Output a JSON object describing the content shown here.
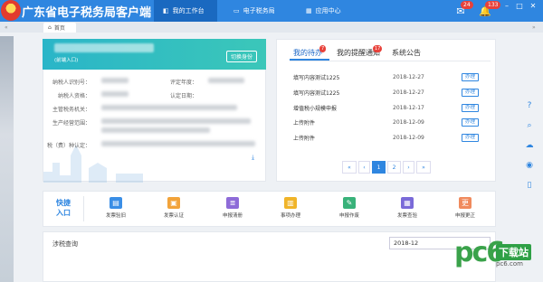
{
  "app": {
    "title": "广东省电子税务局客户端"
  },
  "nav": [
    {
      "label": "我的工作台",
      "icon": "workbench-icon",
      "active": true
    },
    {
      "label": "电子税务局",
      "icon": "tax-bureau-icon",
      "active": false
    },
    {
      "label": "应用中心",
      "icon": "app-center-icon",
      "active": false
    }
  ],
  "toolbar": {
    "message_count": "24",
    "notice_count": "133"
  },
  "tabs": {
    "home": "首页"
  },
  "user": {
    "note": "(前端入口)",
    "switch_label": "切换身份",
    "fields": [
      {
        "label": "纳税人识别号："
      },
      {
        "label": "纳税人资格："
      },
      {
        "label": "主管税务机关："
      },
      {
        "label": "生产经营范围："
      },
      {
        "label": "税（费）种认定："
      }
    ],
    "right_fields": [
      {
        "label": "评定年度："
      },
      {
        "label": "认定日期："
      }
    ]
  },
  "todo": {
    "tabs": [
      {
        "label": "我的待办",
        "badge": "7"
      },
      {
        "label": "我的提醒通知",
        "badge": "17"
      },
      {
        "label": "系统公告",
        "badge": ""
      }
    ],
    "items": [
      {
        "title": "填写内容测试1225",
        "date": "2018-12-27",
        "action": "办理"
      },
      {
        "title": "填写内容测试1225",
        "date": "2018-12-27",
        "action": "办理"
      },
      {
        "title": "增值税小规模申报",
        "date": "2018-12-17",
        "action": "办理"
      },
      {
        "title": "上传附件",
        "date": "2018-12-09",
        "action": "办理"
      },
      {
        "title": "上传附件",
        "date": "2018-12-09",
        "action": "办理"
      }
    ],
    "pager": [
      "«",
      "‹",
      "1",
      "2",
      "›",
      "»"
    ]
  },
  "quick_entry": {
    "title": "快捷入口",
    "items": [
      {
        "label": "发票验旧",
        "color": "#3a8ee6"
      },
      {
        "label": "发票认证",
        "color": "#f2a33a"
      },
      {
        "label": "申报清册",
        "color": "#8e6bd8"
      },
      {
        "label": "事项办理",
        "color": "#f0b429"
      },
      {
        "label": "申报作废",
        "color": "#39b27a"
      },
      {
        "label": "发票查验",
        "color": "#7a6ad8"
      },
      {
        "label": "申报更正",
        "color": "#f08a5d"
      }
    ]
  },
  "query": {
    "title": "涉税查询",
    "date_value": "2018-12"
  },
  "watermark": {
    "brand": "pc6",
    "text": "下载站",
    "url": "pc6.com"
  }
}
